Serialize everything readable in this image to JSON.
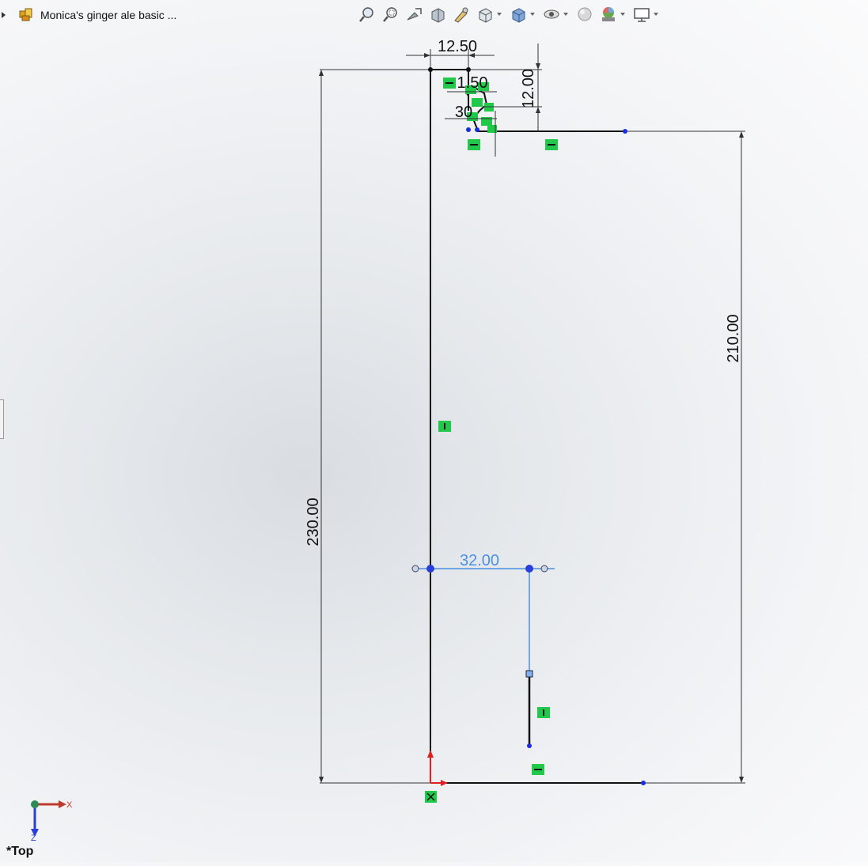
{
  "document": {
    "title": "Monica's ginger ale basic ..."
  },
  "hud_toolbar": {
    "items": [
      {
        "icon": "zoom-to-fit-icon"
      },
      {
        "icon": "zoom-to-area-icon"
      },
      {
        "icon": "previous-view-icon"
      },
      {
        "icon": "section-view-icon"
      },
      {
        "icon": "dynamic-annotation-icon"
      },
      {
        "icon": "view-orientation-icon",
        "dropdown": true
      },
      {
        "icon": "display-style-icon",
        "dropdown": true
      },
      {
        "icon": "hide-show-items-icon",
        "dropdown": true
      },
      {
        "icon": "edit-appearance-icon"
      },
      {
        "icon": "apply-scene-icon",
        "dropdown": true
      },
      {
        "icon": "view-settings-icon",
        "dropdown": true
      }
    ]
  },
  "sketch": {
    "dimensions": {
      "top_width": "12.50",
      "small_width": "1.50",
      "top_offset": "12.00",
      "clip": "30",
      "right_height": "210.00",
      "left_height": "230.00",
      "center_offset": "32.00"
    }
  },
  "triad": {
    "x_label": "X",
    "z_label": "Z"
  },
  "view": {
    "name": "*Top"
  },
  "colors": {
    "sketch_line": "#111111",
    "relation_green": "#22c84a",
    "dim_blue": "#4a90e2",
    "point_blue": "#1a2de0"
  }
}
